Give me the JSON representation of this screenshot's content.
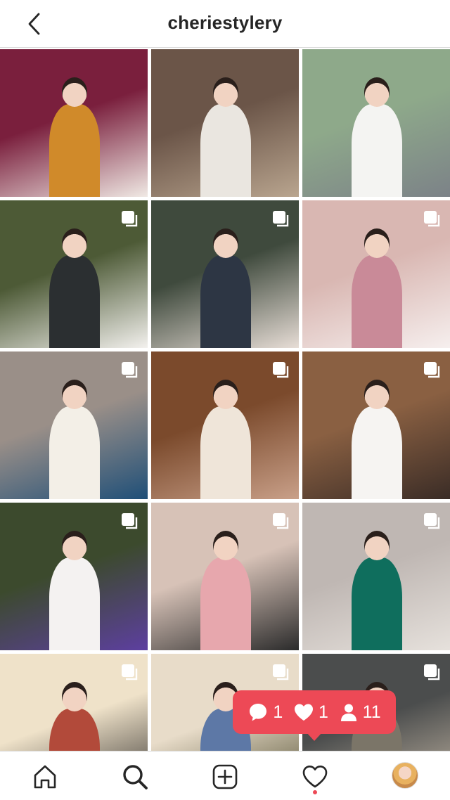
{
  "header": {
    "title": "cheriestylery",
    "back_icon": "chevron-left-icon"
  },
  "grid": {
    "posts": [
      {
        "label": "Post 1",
        "carousel": false,
        "colors": [
          "#7a1f3d",
          "#d08a2a",
          "#f0e9e4"
        ]
      },
      {
        "label": "Post 2",
        "carousel": false,
        "colors": [
          "#6b5548",
          "#eae6e0",
          "#b9a58f"
        ]
      },
      {
        "label": "Post 3",
        "carousel": false,
        "colors": [
          "#8ea98a",
          "#f4f4f2",
          "#7c8288"
        ]
      },
      {
        "label": "Post 4",
        "carousel": true,
        "colors": [
          "#4d5a36",
          "#2b2f31",
          "#f3f1ee"
        ]
      },
      {
        "label": "Post 5",
        "carousel": true,
        "colors": [
          "#3f4a3d",
          "#2d3644",
          "#e7ddd6"
        ]
      },
      {
        "label": "Post 6",
        "carousel": true,
        "colors": [
          "#d9b7b2",
          "#c98a98",
          "#f6efee"
        ]
      },
      {
        "label": "Post 7",
        "carousel": true,
        "colors": [
          "#9a8f88",
          "#f3efe7",
          "#1f4f78"
        ]
      },
      {
        "label": "Post 8",
        "carousel": true,
        "colors": [
          "#7b4a2c",
          "#efe5d9",
          "#c9a089"
        ]
      },
      {
        "label": "Post 9",
        "carousel": true,
        "colors": [
          "#8a6042",
          "#f6f4f2",
          "#3a2c26"
        ]
      },
      {
        "label": "Post 10",
        "carousel": true,
        "colors": [
          "#3c4a2d",
          "#f4f2f1",
          "#5d3fa0"
        ]
      },
      {
        "label": "Post 11",
        "carousel": true,
        "colors": [
          "#d7c2b7",
          "#e7a7ad",
          "#2b2b2b"
        ]
      },
      {
        "label": "Post 12",
        "carousel": true,
        "colors": [
          "#bfb7b3",
          "#0f6e5d",
          "#e6e1dc"
        ]
      },
      {
        "label": "Post 13",
        "carousel": true,
        "colors": [
          "#efe2c9",
          "#b24a3a",
          "#2d2a28"
        ]
      },
      {
        "label": "Post 14",
        "carousel": true,
        "colors": [
          "#e8dcc9",
          "#5d78a6",
          "#4d4a2c"
        ]
      },
      {
        "label": "Post 15",
        "carousel": true,
        "colors": [
          "#4b4d4d",
          "#7b7568",
          "#c5b8a6"
        ]
      }
    ]
  },
  "notification": {
    "comments_count": "1",
    "likes_count": "1",
    "followers_count": "11",
    "comment_icon": "comment-bubble-icon",
    "like_icon": "heart-icon",
    "follower_icon": "person-icon",
    "color": "#ed4956"
  },
  "bottom_nav": {
    "home_icon": "home-icon",
    "search_icon": "search-icon",
    "add_icon": "add-post-icon",
    "activity_icon": "heart-outline-icon",
    "profile_icon": "profile-avatar-icon"
  }
}
